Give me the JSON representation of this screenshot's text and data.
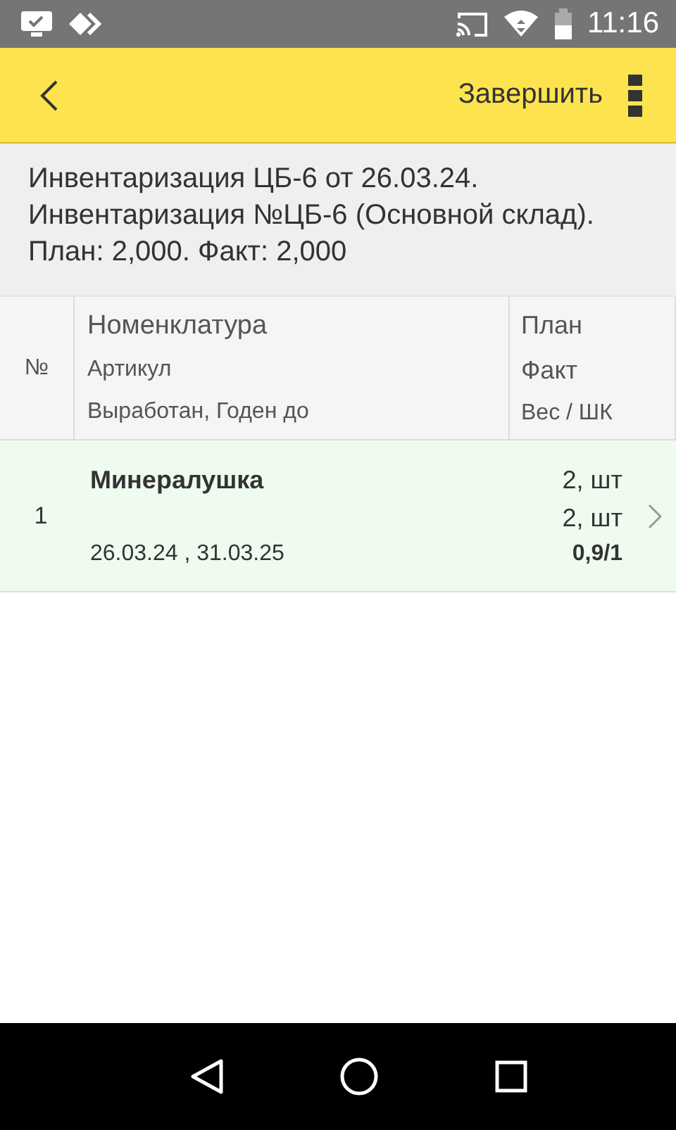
{
  "status_bar": {
    "time": "11:16"
  },
  "toolbar": {
    "action": "Завершить"
  },
  "header": {
    "text": "Инвентаризация ЦБ-6 от 26.03.24. Инвентаризация №ЦБ-6 (Основной склад). План: 2,000. Факт: 2,000"
  },
  "table": {
    "columns": {
      "number": "№",
      "name": [
        "Номенклатура",
        "Артикул",
        "Выработан, Годен до"
      ],
      "quantity": [
        "План",
        "Факт",
        "Вес / ШК"
      ]
    },
    "rows": [
      {
        "number": "1",
        "name": "Минералушка",
        "dates": "26.03.24  , 31.03.25",
        "plan": "2, шт",
        "fact": "2, шт",
        "weight": "0,9/1"
      }
    ]
  }
}
